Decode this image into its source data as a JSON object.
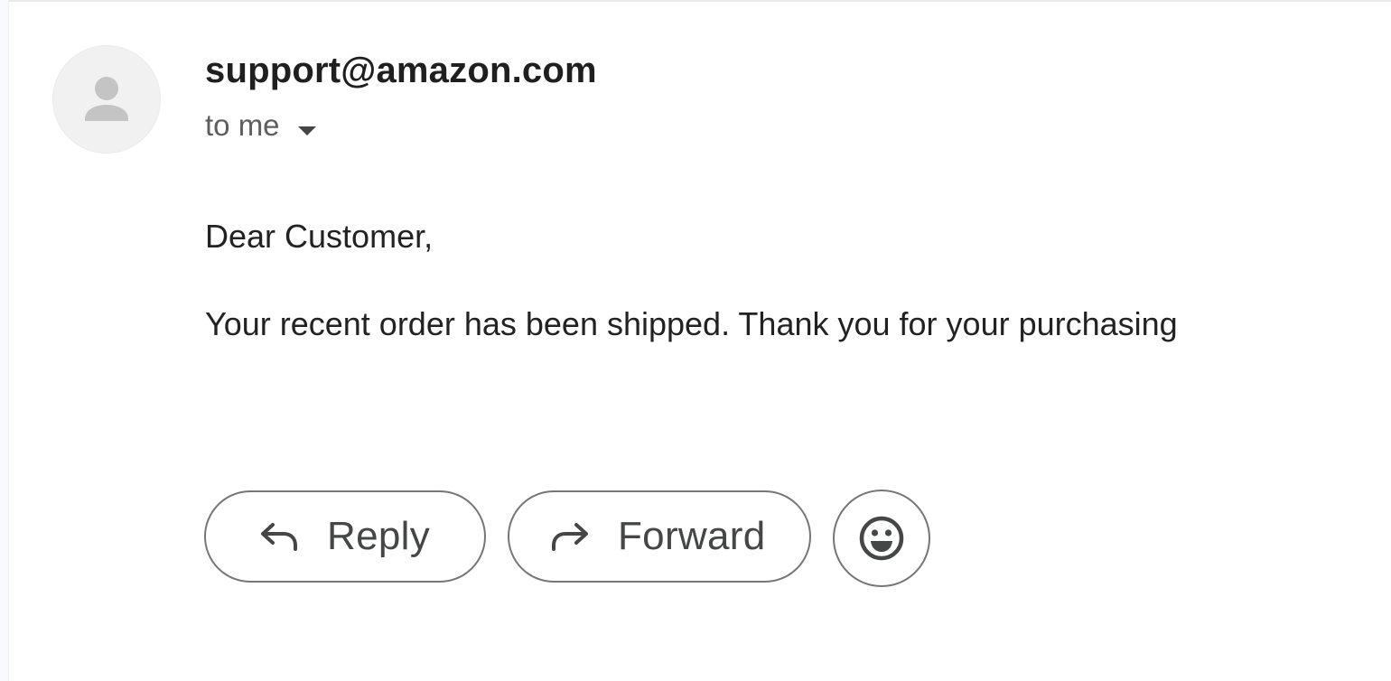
{
  "email": {
    "sender": "support@amazon.com",
    "recipient_label": "to me",
    "body": {
      "greeting": "Dear Customer,",
      "lines": [
        "Your recent order has been shipped. Thank you for your purchasing"
      ]
    }
  },
  "actions": {
    "reply_label": "Reply",
    "forward_label": "Forward",
    "emoji_icon": "emoji-smile-icon"
  },
  "icons": {
    "avatar": "default-person-icon",
    "recipient_toggle": "caret-down-icon",
    "reply": "reply-arrow-icon",
    "forward": "forward-arrow-icon"
  },
  "colors": {
    "text_primary": "#1f1f1f",
    "text_secondary": "#5e5e5e",
    "button_border": "#747775",
    "avatar_bg": "#f1f1f1"
  }
}
